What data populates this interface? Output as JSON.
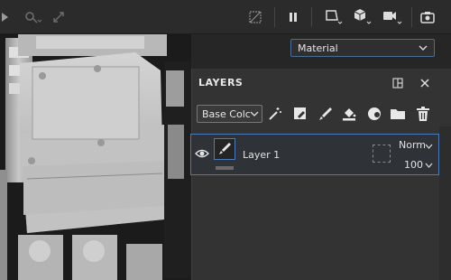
{
  "toolbar": {
    "icons": [
      "symmetry-icon",
      "brush-settings-icon",
      "transform-icon",
      "grid-toggle-icon",
      "pause-icon",
      "view-shape-icon",
      "cube-view-icon",
      "camera-record-icon",
      "screenshot-icon"
    ]
  },
  "viewport": {
    "material_select": "Material"
  },
  "layers_panel": {
    "title": "LAYERS",
    "channel_select": "Base Colc",
    "tools": [
      "magic-wand-icon",
      "fill-layer-icon",
      "paint-brush-icon",
      "fill-bucket-icon",
      "color-picker-icon",
      "folder-icon",
      "trash-icon"
    ],
    "layers": [
      {
        "name": "Layer 1",
        "blend_mode": "Norm",
        "opacity": "100",
        "visible": true
      }
    ]
  },
  "colors": {
    "accent": "#4a7bb8",
    "panel_bg": "#333333",
    "toolbar_bg": "#2b2b2b"
  }
}
